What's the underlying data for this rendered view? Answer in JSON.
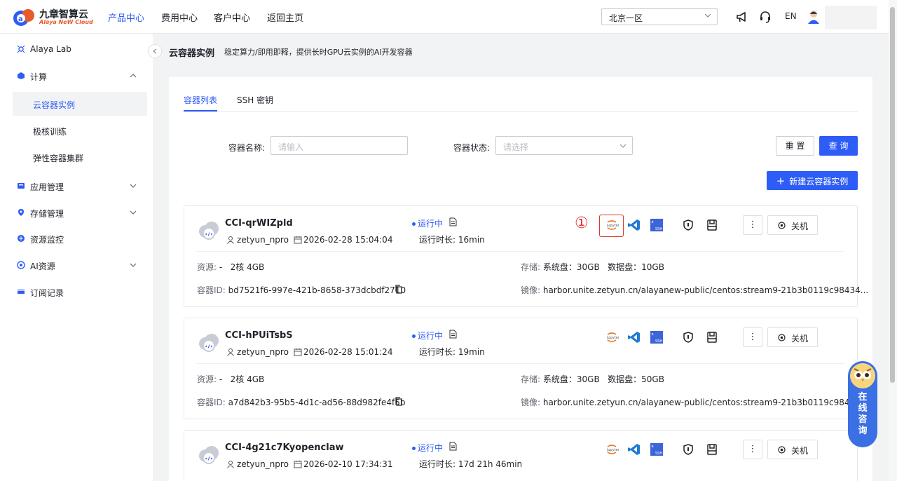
{
  "brand": {
    "name_cn": "九章智算云",
    "name_en": "Alaya NeW Cloud",
    "accent": "#2e5cf6",
    "logo_color": "#e65a2b"
  },
  "nav": {
    "items": [
      {
        "label": "产品中心",
        "active": true
      },
      {
        "label": "费用中心",
        "active": false
      },
      {
        "label": "客户中心",
        "active": false
      },
      {
        "label": "返回主页",
        "active": false
      }
    ]
  },
  "header": {
    "region": "北京一区",
    "lang": "EN",
    "icons": [
      "megaphone-icon",
      "headset-icon",
      "user-avatar-icon"
    ]
  },
  "sidebar": {
    "items": [
      {
        "label": "Alaya Lab",
        "icon": "lab-icon"
      },
      {
        "label": "计算",
        "icon": "compute-icon",
        "expanded": true
      },
      {
        "label": "应用管理",
        "icon": "app-icon"
      },
      {
        "label": "存储管理",
        "icon": "storage-icon"
      },
      {
        "label": "资源监控",
        "icon": "monitor-icon"
      },
      {
        "label": "AI资源",
        "icon": "ai-icon"
      },
      {
        "label": "订阅记录",
        "icon": "subscribe-icon"
      }
    ],
    "sub_items": [
      {
        "label": "云容器实例",
        "active": true
      },
      {
        "label": "极核训练",
        "active": false
      },
      {
        "label": "弹性容器集群",
        "active": false
      }
    ]
  },
  "page": {
    "title": "云容器实例",
    "subtitle": "稳定算力/即用即释，提供长时GPU云实例的AI开发容器"
  },
  "tabs": [
    {
      "label": "容器列表",
      "active": true
    },
    {
      "label": "SSH 密钥",
      "active": false
    }
  ],
  "filters": {
    "name_label": "容器名称:",
    "name_placeholder": "请输入",
    "status_label": "容器状态:",
    "status_placeholder": "请选择",
    "reset": "重 置",
    "query": "查 询",
    "create": "新建云容器实例"
  },
  "labels": {
    "resource": "资源:",
    "storage": "存储:",
    "container_id": "容器ID:",
    "image": "镜像:",
    "uptime": "运行时长:",
    "power_off": "关机",
    "more": "⋮",
    "marker": "①"
  },
  "instances": [
    {
      "name": "CCI-qrWIZpld",
      "user": "zetyun_npro",
      "created": "2026-02-28 15:04:04",
      "status": "运行中",
      "uptime": "16min",
      "resource_prefix": "-",
      "resource": "2核 4GB",
      "system_disk": "系统盘：30GB",
      "data_disk": "数据盘：10GB",
      "id": "bd7521f6-997e-421b-8658-373dcbdf2710",
      "image": "harbor.unite.zetyun.cn/alayanew-public/centos:stream9-21b3b0119c98434..."
    },
    {
      "name": "CCI-hPUiTsbS",
      "user": "zetyun_npro",
      "created": "2026-02-28 15:01:24",
      "status": "运行中",
      "uptime": "19min",
      "resource_prefix": "-",
      "resource": "2核 4GB",
      "system_disk": "系统盘：30GB",
      "data_disk": "数据盘：50GB",
      "id": "a7d842b3-95b5-4d1c-ad56-88d982fe4f5b",
      "image": "harbor.unite.zetyun.cn/alayanew-public/centos:stream9-21b3b0119c98434..."
    },
    {
      "name": "CCI-4g21c7Kyopenclaw",
      "user": "zetyun_npro",
      "created": "2026-02-10 17:34:31",
      "status": "运行中",
      "uptime": "17d 21h 46min"
    }
  ],
  "chat_widget": {
    "label": "在线咨询",
    "chars": [
      "在",
      "线",
      "咨",
      "询"
    ]
  }
}
